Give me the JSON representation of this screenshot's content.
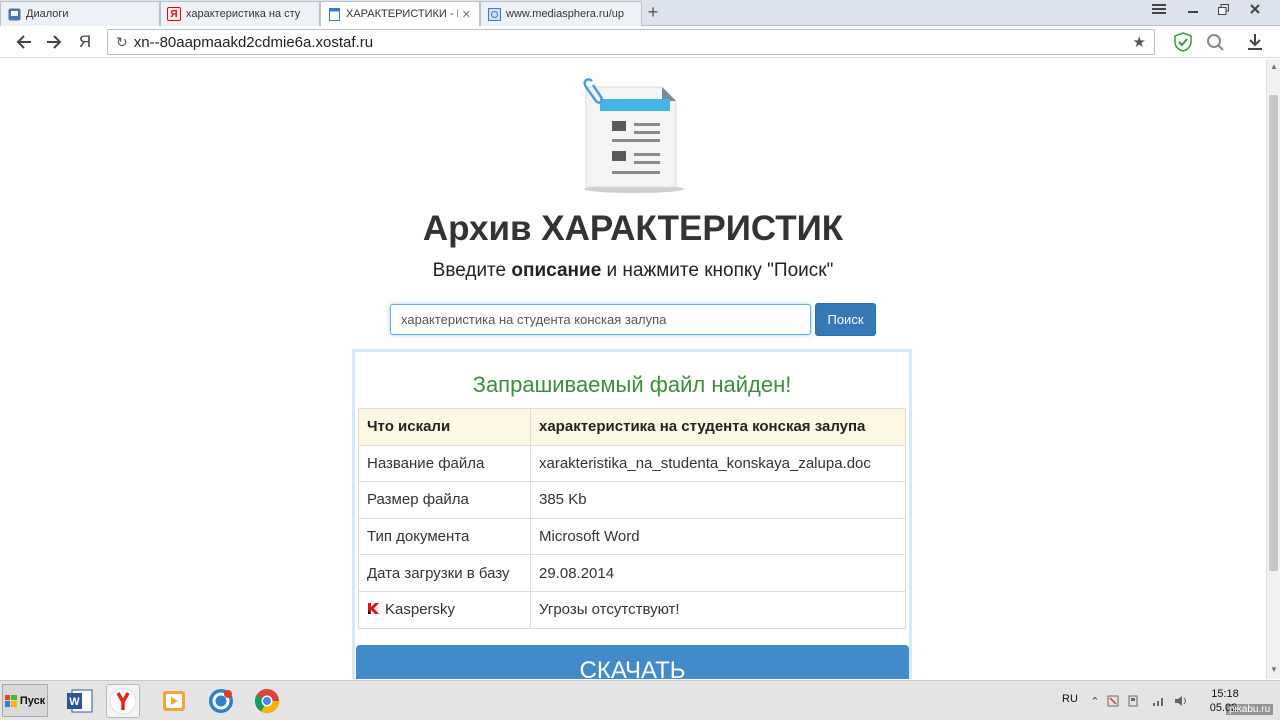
{
  "browser": {
    "tabs": [
      {
        "label": "Диалоги",
        "icon": "vk-dialog-icon"
      },
      {
        "label": "характеристика на сту",
        "icon": "yandex-icon"
      },
      {
        "label": "ХАРАКТЕРИСТИКИ - Все",
        "icon": "document-icon",
        "active": true
      },
      {
        "label": "www.mediasphera.ru/up",
        "icon": "globe-icon"
      }
    ],
    "yandex_letter": "Я",
    "url": "xn--80aapmaakd2cdmie6a.xostaf.ru"
  },
  "page": {
    "title": "Архив ХАРАКТЕРИСТИК",
    "subtitle_pre": "Введите ",
    "subtitle_bold": "описание",
    "subtitle_post": " и нажмите кнопку \"Поиск\"",
    "search_value": "характеристика на студента конская залупа",
    "search_button": "Поиск",
    "found_title": "Запрашиваемый файл найден!",
    "table": {
      "head": {
        "label": "Что искали",
        "value": "характеристика на студента конская залупа"
      },
      "rows": [
        {
          "label": "Название файла",
          "value": "xarakteristika_na_studenta_konskaya_zalupa.doc"
        },
        {
          "label": "Размер файла",
          "value": "385 Kb"
        },
        {
          "label": "Тип документа",
          "value": "Microsoft Word"
        },
        {
          "label": "Дата загрузки в базу",
          "value": "29.08.2014"
        },
        {
          "label": "Kaspersky",
          "value": "Угрозы отсутствуют!"
        }
      ]
    },
    "download_button": "СКАЧАТЬ"
  },
  "taskbar": {
    "start_label": "Пуск",
    "apps": [
      "word-icon",
      "yandex-browser-icon",
      "media-player-icon",
      "app-icon",
      "chrome-icon"
    ],
    "lang": "RU",
    "time": "15:18",
    "date": "05.02.",
    "watermark": "pikabu.ru"
  },
  "colors": {
    "accent_blue": "#337ab7",
    "download_blue": "#428bca",
    "found_green": "#3c8d3c",
    "head_row": "#fcf8e3"
  }
}
